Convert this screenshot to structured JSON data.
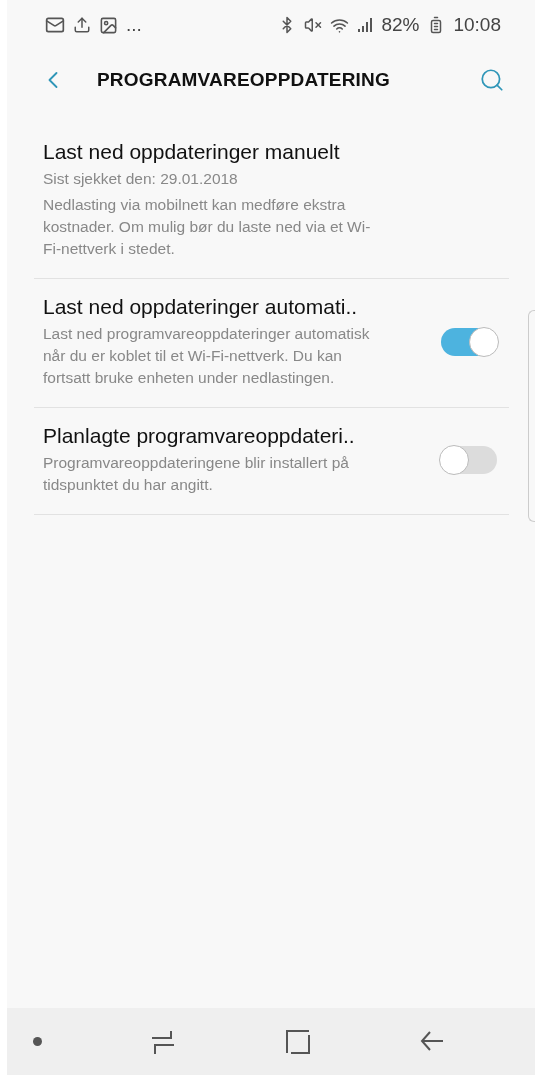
{
  "status_bar": {
    "overflow": "...",
    "battery": "82%",
    "time": "10:08"
  },
  "header": {
    "title": "PROGRAMVAREOPPDATERING"
  },
  "settings": [
    {
      "kind": "plain",
      "title": "Last ned oppdateringer manuelt",
      "subtitle": "Sist sjekket den: 29.01.2018",
      "description": "Nedlasting via mobilnett kan medføre ekstra kostnader. Om mulig bør du laste ned via et Wi-Fi-nettverk i stedet."
    },
    {
      "kind": "switch",
      "title": "Last ned oppdateringer automati..",
      "description": "Last ned programvareoppdateringer automatisk når du er koblet til et Wi-Fi-nettverk. Du kan fortsatt bruke enheten under nedlastingen.",
      "on": true
    },
    {
      "kind": "switch",
      "title": "Planlagte programvareoppdateri..",
      "description": "Programvareoppdateringene blir installert på tidspunktet du har angitt.",
      "on": false
    }
  ]
}
